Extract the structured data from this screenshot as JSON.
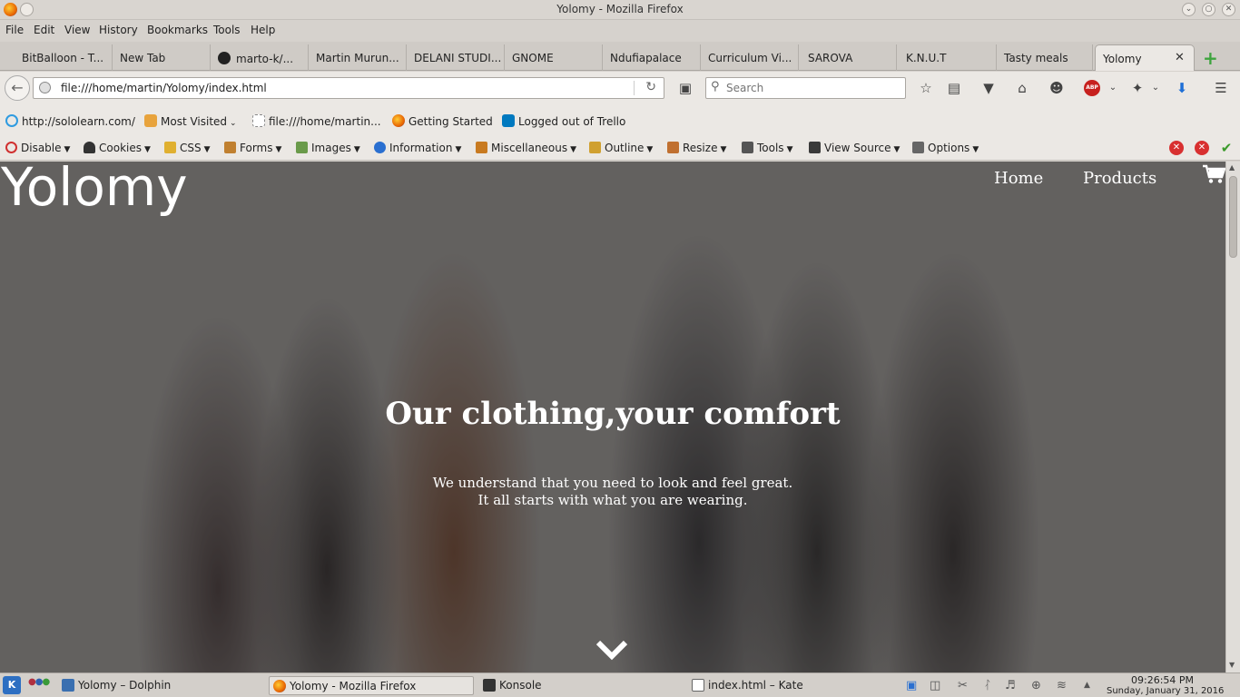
{
  "window": {
    "title": "Yolomy - Mozilla Firefox"
  },
  "menu": [
    "File",
    "Edit",
    "View",
    "History",
    "Bookmarks",
    "Tools",
    "Help"
  ],
  "tabs": [
    {
      "label": "BitBalloon - T..."
    },
    {
      "label": "New Tab"
    },
    {
      "label": "marto-k/..."
    },
    {
      "label": "Martin Murun..."
    },
    {
      "label": "DELANI STUDI..."
    },
    {
      "label": "GNOME"
    },
    {
      "label": "Ndufiapalace"
    },
    {
      "label": "Curriculum Vi..."
    },
    {
      "label": "SAROVA"
    },
    {
      "label": "K.N.U.T"
    },
    {
      "label": "Tasty meals"
    },
    {
      "label": "Yolomy"
    }
  ],
  "navbar": {
    "url": "file:///home/martin/Yolomy/index.html",
    "search_placeholder": "Search",
    "abp_label": "ABP"
  },
  "bookmarks": [
    {
      "label": "http://sololearn.com/",
      "icon": "sololearn-icon",
      "color": "#2f9be0"
    },
    {
      "label": "Most Visited",
      "icon": "folder-icon",
      "color": "#e8a33c"
    },
    {
      "label": "file:///home/martin...",
      "icon": "blank-page-icon",
      "color": "#ffffff"
    },
    {
      "label": "Getting Started",
      "icon": "firefox-icon",
      "color": "#e66000"
    },
    {
      "label": "Logged out of Trello",
      "icon": "trello-icon",
      "color": "#0079bf"
    }
  ],
  "devtools": [
    {
      "label": "Disable",
      "icon": "disable-icon",
      "color": "#d03030"
    },
    {
      "label": "Cookies",
      "icon": "cookies-icon",
      "color": "#333333"
    },
    {
      "label": "CSS",
      "icon": "css-icon",
      "color": "#e0b030"
    },
    {
      "label": "Forms",
      "icon": "forms-icon",
      "color": "#c08030"
    },
    {
      "label": "Images",
      "icon": "images-icon",
      "color": "#6a9a4a"
    },
    {
      "label": "Information",
      "icon": "information-icon",
      "color": "#2a6fd0"
    },
    {
      "label": "Miscellaneous",
      "icon": "miscellaneous-icon",
      "color": "#c87a20"
    },
    {
      "label": "Outline",
      "icon": "outline-icon",
      "color": "#d0a030"
    },
    {
      "label": "Resize",
      "icon": "resize-icon",
      "color": "#c07030"
    },
    {
      "label": "Tools",
      "icon": "tools-icon",
      "color": "#555555"
    },
    {
      "label": "View Source",
      "icon": "view-source-icon",
      "color": "#3a3a3a"
    },
    {
      "label": "Options",
      "icon": "options-icon",
      "color": "#666666"
    }
  ],
  "page": {
    "logo": "Yolomy",
    "nav": [
      "Home",
      "Products"
    ],
    "hero_title": "Our clothing,your comfort",
    "hero_sub_line1": "We understand that you need to look and feel great.",
    "hero_sub_line2": "It all starts with what you are wearing."
  },
  "taskbar": {
    "tasks": [
      {
        "label": "Yolomy – Dolphin",
        "icon": "dolphin-icon",
        "color": "#3a6fb0"
      },
      {
        "label": "Yolomy - Mozilla Firefox",
        "icon": "firefox-icon",
        "color": "#e66000"
      },
      {
        "label": "Konsole",
        "icon": "konsole-icon",
        "color": "#333333"
      },
      {
        "label": "index.html – Kate",
        "icon": "kate-icon",
        "color": "#666666"
      }
    ],
    "time": "09:26:54 PM",
    "date": "Sunday, January 31, 2016"
  }
}
